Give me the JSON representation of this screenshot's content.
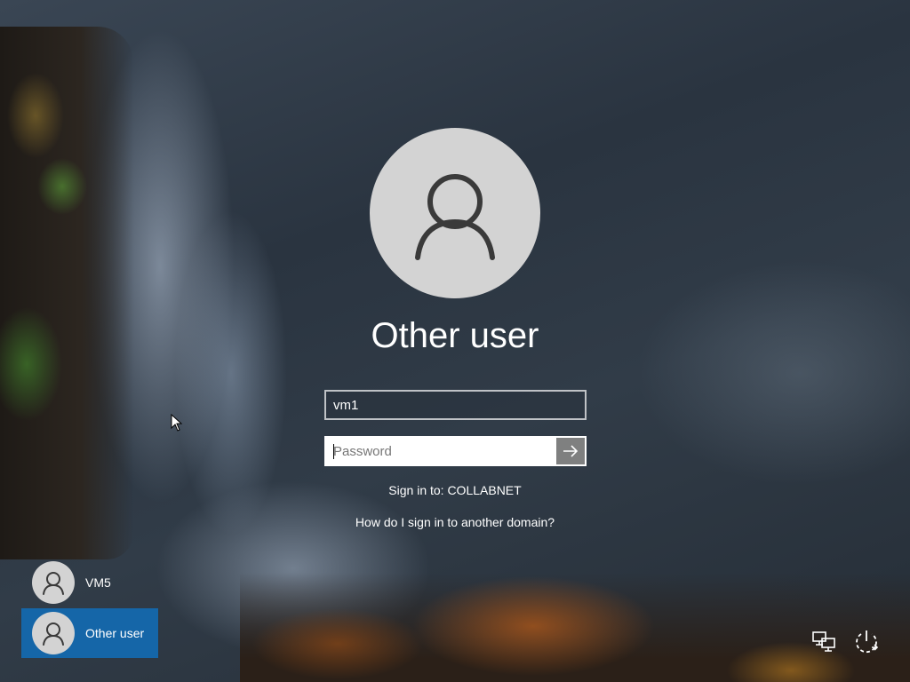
{
  "signin": {
    "user_title": "Other user",
    "username_value": "vm1",
    "password_placeholder": "Password",
    "sign_in_to": "Sign in to: COLLABNET",
    "other_domain_link": "How do I sign in to another domain?"
  },
  "user_list": [
    {
      "name": "VM5",
      "selected": false
    },
    {
      "name": "Other user",
      "selected": true
    }
  ],
  "system_icons": {
    "network": "network-icon",
    "power": "power-icon"
  },
  "colors": {
    "selected_user_bg": "#1566a8",
    "avatar_bg": "#d3d3d3",
    "submit_button_bg": "#7f8080"
  }
}
